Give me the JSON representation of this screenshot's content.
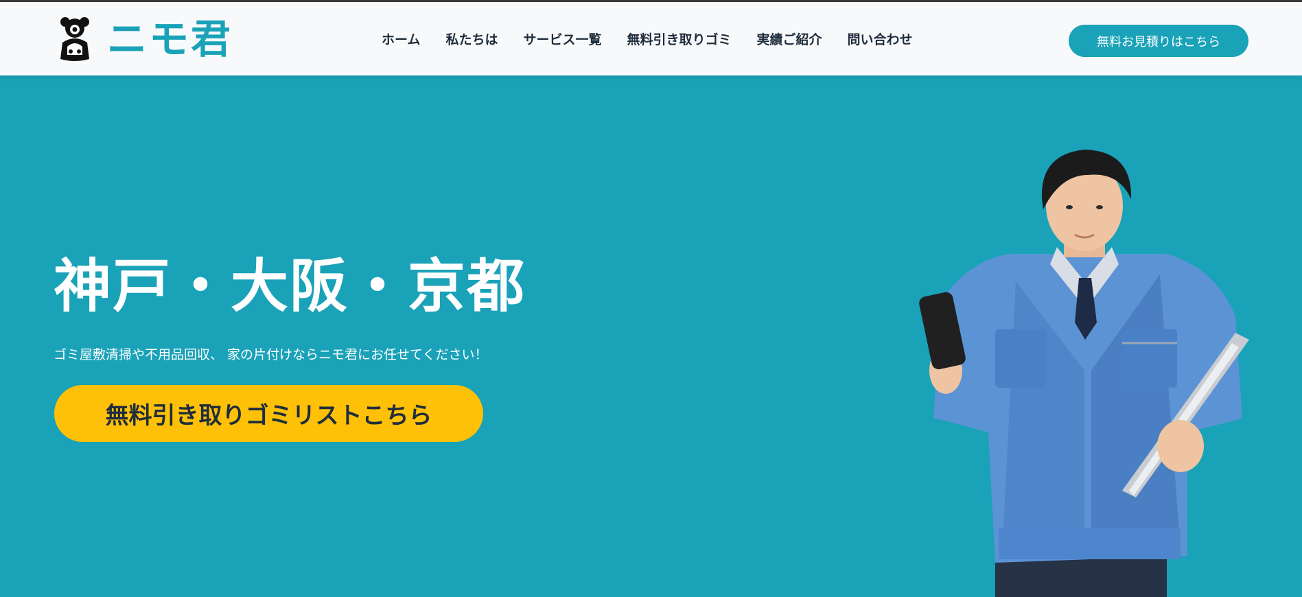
{
  "header": {
    "logo": {
      "text": "ニモ君",
      "icon": "bear-mascot-icon"
    },
    "nav": [
      "ホーム",
      "私たちは",
      "サービス一覧",
      "無料引き取りゴミ",
      "実績ご紹介",
      "問い合わせ"
    ],
    "cta_label": "無料お見積りはこちら"
  },
  "hero": {
    "title": "神戸・大阪・京都",
    "subtitle": "ゴミ屋敷清掃や不用品回収、 家の片付けならニモ君にお任せてください！",
    "cta_label": "無料引き取りゴミリストこちら",
    "image": "worker-in-blue-uniform-with-phone-and-clipboard"
  },
  "colors": {
    "brand": "#19a2b8",
    "header_bg": "#f8f9fa",
    "nav_text": "#1f2d3d",
    "accent_button": "#ffc107",
    "white": "#ffffff"
  }
}
